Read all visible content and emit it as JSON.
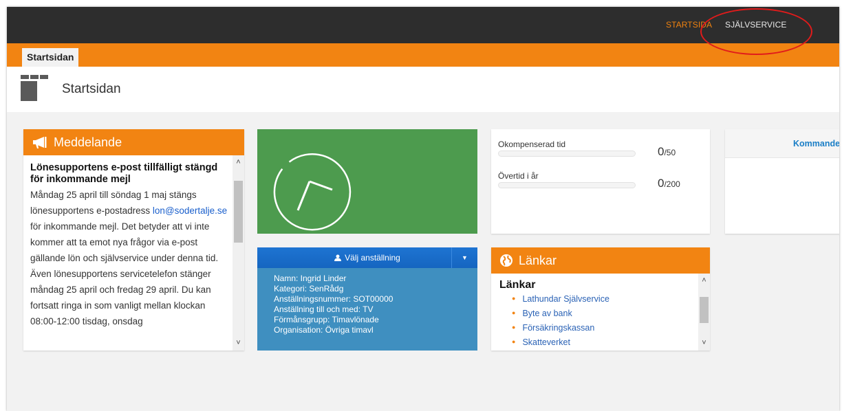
{
  "topnav": {
    "startsida": "STARTSIDA",
    "sjalvservice": "SJÄLVSERVICE"
  },
  "tabs": [
    {
      "label": "Startsidan",
      "active": true
    }
  ],
  "header": {
    "title": "Startsidan",
    "icon": "layout-icon"
  },
  "message_panel": {
    "title": "Meddelande",
    "icon": "megaphone-icon",
    "heading": "Lönesupportens e-post tillfälligt stängd för inkommande mejl",
    "line1": "Måndag 25 april till söndag 1 maj stängs lönesupportens e-postadress",
    "email": "lon@sodertalje.se",
    "line2": " för inkommande mejl. Det betyder att vi inte kommer att ta emot nya frågor via e-post gällande lön och självservice under denna tid.",
    "line3": "Även lönesupportens servicetelefon stänger måndag 25 april och fredag 29 april. Du kan fortsatt ringa in som vanligt mellan klockan 08:00-12:00 tisdag, onsdag"
  },
  "clock_panel": {
    "icon": "clock-icon"
  },
  "employment": {
    "button_label": "Välj anställning",
    "lines": [
      "Namn: Ingrid Linder",
      "Kategori: SenRådg",
      "Anställningsnummer: SOT00000",
      "Anställning till och med: TV",
      "Förmånsgrupp: Timavlönade",
      "Organisation: Övriga timavl"
    ]
  },
  "time_panel": {
    "rows": [
      {
        "label": "Okompenserad tid",
        "value": "0",
        "max": "/50",
        "fraction": 0
      },
      {
        "label": "Övertid i år",
        "value": "0",
        "max": "/200",
        "fraction": 0
      }
    ]
  },
  "links_panel": {
    "header": "Länkar",
    "title": "Länkar",
    "icon": "globe-icon",
    "items": [
      "Lathundar Självservice",
      "Byte av bank",
      "Försäkringskassan",
      "Skatteverket"
    ]
  },
  "upcoming_panel": {
    "header": "Kommande"
  },
  "colors": {
    "accent": "#f28412",
    "topbar": "#2d2d2d",
    "clock_green": "#4d9b4e",
    "employment_blue": "#3f8fc0",
    "button_blue": "#1565c0",
    "highlight": "#e11b1b"
  }
}
